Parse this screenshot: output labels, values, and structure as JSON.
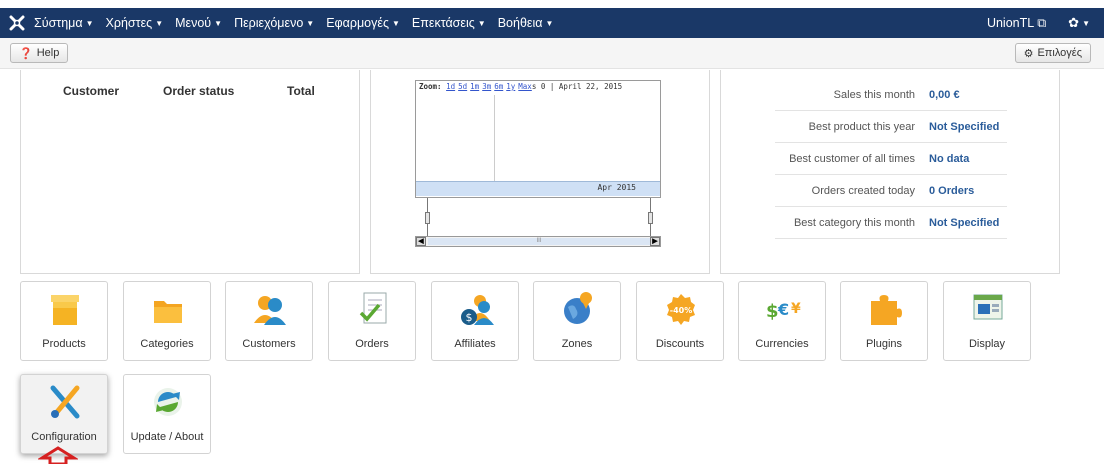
{
  "topbar": {
    "menu": [
      "Σύστημα",
      "Χρήστες",
      "Μενού",
      "Περιεχόμενο",
      "Εφαρμογές",
      "Επεκτάσεις",
      "Βοήθεια"
    ],
    "user": "UnionTL",
    "colors": {
      "bar": "#1a3867"
    }
  },
  "toolbar": {
    "help": "Help",
    "options": "Επιλογές"
  },
  "orders": {
    "headers": [
      "Customer",
      "Order status",
      "Total"
    ]
  },
  "chart": {
    "zoom_label": "Zoom:",
    "zoom_links": [
      "1d",
      "5d",
      "1m",
      "3m",
      "6m",
      "1y",
      "Max"
    ],
    "range_text": "s 0 | April 22, 2015",
    "axis_label": "Apr 2015",
    "scroll_text": "III"
  },
  "stats": [
    {
      "label": "Sales this month",
      "value": "0,00 €"
    },
    {
      "label": "Best product this year",
      "value": "Not Specified"
    },
    {
      "label": "Best customer of all times",
      "value": "No data"
    },
    {
      "label": "Orders created today",
      "value": "0 Orders"
    },
    {
      "label": "Best category this month",
      "value": "Not Specified"
    }
  ],
  "quick_icons": [
    {
      "label": "Products",
      "icon": "box-icon"
    },
    {
      "label": "Categories",
      "icon": "folder-icon"
    },
    {
      "label": "Customers",
      "icon": "users-icon"
    },
    {
      "label": "Orders",
      "icon": "order-document-icon"
    },
    {
      "label": "Affiliates",
      "icon": "affiliate-money-icon"
    },
    {
      "label": "Zones",
      "icon": "globe-pin-icon"
    },
    {
      "label": "Discounts",
      "icon": "discount-badge-icon"
    },
    {
      "label": "Currencies",
      "icon": "currency-symbols-icon"
    },
    {
      "label": "Plugins",
      "icon": "puzzle-icon"
    },
    {
      "label": "Display",
      "icon": "display-window-icon"
    },
    {
      "label": "Configuration",
      "icon": "wrench-screwdriver-icon"
    },
    {
      "label": "Update / About",
      "icon": "refresh-arrows-icon"
    }
  ]
}
